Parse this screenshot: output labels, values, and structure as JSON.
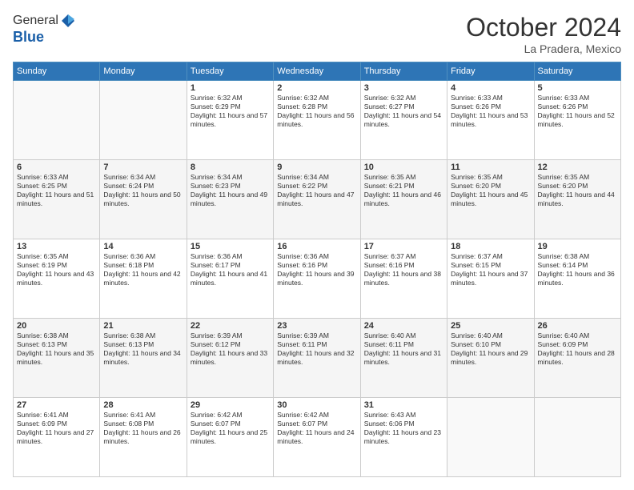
{
  "header": {
    "logo_general": "General",
    "logo_blue": "Blue",
    "month": "October 2024",
    "location": "La Pradera, Mexico"
  },
  "days_of_week": [
    "Sunday",
    "Monday",
    "Tuesday",
    "Wednesday",
    "Thursday",
    "Friday",
    "Saturday"
  ],
  "weeks": [
    [
      {
        "day": "",
        "sunrise": "",
        "sunset": "",
        "daylight": ""
      },
      {
        "day": "",
        "sunrise": "",
        "sunset": "",
        "daylight": ""
      },
      {
        "day": "1",
        "sunrise": "Sunrise: 6:32 AM",
        "sunset": "Sunset: 6:29 PM",
        "daylight": "Daylight: 11 hours and 57 minutes."
      },
      {
        "day": "2",
        "sunrise": "Sunrise: 6:32 AM",
        "sunset": "Sunset: 6:28 PM",
        "daylight": "Daylight: 11 hours and 56 minutes."
      },
      {
        "day": "3",
        "sunrise": "Sunrise: 6:32 AM",
        "sunset": "Sunset: 6:27 PM",
        "daylight": "Daylight: 11 hours and 54 minutes."
      },
      {
        "day": "4",
        "sunrise": "Sunrise: 6:33 AM",
        "sunset": "Sunset: 6:26 PM",
        "daylight": "Daylight: 11 hours and 53 minutes."
      },
      {
        "day": "5",
        "sunrise": "Sunrise: 6:33 AM",
        "sunset": "Sunset: 6:26 PM",
        "daylight": "Daylight: 11 hours and 52 minutes."
      }
    ],
    [
      {
        "day": "6",
        "sunrise": "Sunrise: 6:33 AM",
        "sunset": "Sunset: 6:25 PM",
        "daylight": "Daylight: 11 hours and 51 minutes."
      },
      {
        "day": "7",
        "sunrise": "Sunrise: 6:34 AM",
        "sunset": "Sunset: 6:24 PM",
        "daylight": "Daylight: 11 hours and 50 minutes."
      },
      {
        "day": "8",
        "sunrise": "Sunrise: 6:34 AM",
        "sunset": "Sunset: 6:23 PM",
        "daylight": "Daylight: 11 hours and 49 minutes."
      },
      {
        "day": "9",
        "sunrise": "Sunrise: 6:34 AM",
        "sunset": "Sunset: 6:22 PM",
        "daylight": "Daylight: 11 hours and 47 minutes."
      },
      {
        "day": "10",
        "sunrise": "Sunrise: 6:35 AM",
        "sunset": "Sunset: 6:21 PM",
        "daylight": "Daylight: 11 hours and 46 minutes."
      },
      {
        "day": "11",
        "sunrise": "Sunrise: 6:35 AM",
        "sunset": "Sunset: 6:20 PM",
        "daylight": "Daylight: 11 hours and 45 minutes."
      },
      {
        "day": "12",
        "sunrise": "Sunrise: 6:35 AM",
        "sunset": "Sunset: 6:20 PM",
        "daylight": "Daylight: 11 hours and 44 minutes."
      }
    ],
    [
      {
        "day": "13",
        "sunrise": "Sunrise: 6:35 AM",
        "sunset": "Sunset: 6:19 PM",
        "daylight": "Daylight: 11 hours and 43 minutes."
      },
      {
        "day": "14",
        "sunrise": "Sunrise: 6:36 AM",
        "sunset": "Sunset: 6:18 PM",
        "daylight": "Daylight: 11 hours and 42 minutes."
      },
      {
        "day": "15",
        "sunrise": "Sunrise: 6:36 AM",
        "sunset": "Sunset: 6:17 PM",
        "daylight": "Daylight: 11 hours and 41 minutes."
      },
      {
        "day": "16",
        "sunrise": "Sunrise: 6:36 AM",
        "sunset": "Sunset: 6:16 PM",
        "daylight": "Daylight: 11 hours and 39 minutes."
      },
      {
        "day": "17",
        "sunrise": "Sunrise: 6:37 AM",
        "sunset": "Sunset: 6:16 PM",
        "daylight": "Daylight: 11 hours and 38 minutes."
      },
      {
        "day": "18",
        "sunrise": "Sunrise: 6:37 AM",
        "sunset": "Sunset: 6:15 PM",
        "daylight": "Daylight: 11 hours and 37 minutes."
      },
      {
        "day": "19",
        "sunrise": "Sunrise: 6:38 AM",
        "sunset": "Sunset: 6:14 PM",
        "daylight": "Daylight: 11 hours and 36 minutes."
      }
    ],
    [
      {
        "day": "20",
        "sunrise": "Sunrise: 6:38 AM",
        "sunset": "Sunset: 6:13 PM",
        "daylight": "Daylight: 11 hours and 35 minutes."
      },
      {
        "day": "21",
        "sunrise": "Sunrise: 6:38 AM",
        "sunset": "Sunset: 6:13 PM",
        "daylight": "Daylight: 11 hours and 34 minutes."
      },
      {
        "day": "22",
        "sunrise": "Sunrise: 6:39 AM",
        "sunset": "Sunset: 6:12 PM",
        "daylight": "Daylight: 11 hours and 33 minutes."
      },
      {
        "day": "23",
        "sunrise": "Sunrise: 6:39 AM",
        "sunset": "Sunset: 6:11 PM",
        "daylight": "Daylight: 11 hours and 32 minutes."
      },
      {
        "day": "24",
        "sunrise": "Sunrise: 6:40 AM",
        "sunset": "Sunset: 6:11 PM",
        "daylight": "Daylight: 11 hours and 31 minutes."
      },
      {
        "day": "25",
        "sunrise": "Sunrise: 6:40 AM",
        "sunset": "Sunset: 6:10 PM",
        "daylight": "Daylight: 11 hours and 29 minutes."
      },
      {
        "day": "26",
        "sunrise": "Sunrise: 6:40 AM",
        "sunset": "Sunset: 6:09 PM",
        "daylight": "Daylight: 11 hours and 28 minutes."
      }
    ],
    [
      {
        "day": "27",
        "sunrise": "Sunrise: 6:41 AM",
        "sunset": "Sunset: 6:09 PM",
        "daylight": "Daylight: 11 hours and 27 minutes."
      },
      {
        "day": "28",
        "sunrise": "Sunrise: 6:41 AM",
        "sunset": "Sunset: 6:08 PM",
        "daylight": "Daylight: 11 hours and 26 minutes."
      },
      {
        "day": "29",
        "sunrise": "Sunrise: 6:42 AM",
        "sunset": "Sunset: 6:07 PM",
        "daylight": "Daylight: 11 hours and 25 minutes."
      },
      {
        "day": "30",
        "sunrise": "Sunrise: 6:42 AM",
        "sunset": "Sunset: 6:07 PM",
        "daylight": "Daylight: 11 hours and 24 minutes."
      },
      {
        "day": "31",
        "sunrise": "Sunrise: 6:43 AM",
        "sunset": "Sunset: 6:06 PM",
        "daylight": "Daylight: 11 hours and 23 minutes."
      },
      {
        "day": "",
        "sunrise": "",
        "sunset": "",
        "daylight": ""
      },
      {
        "day": "",
        "sunrise": "",
        "sunset": "",
        "daylight": ""
      }
    ]
  ]
}
